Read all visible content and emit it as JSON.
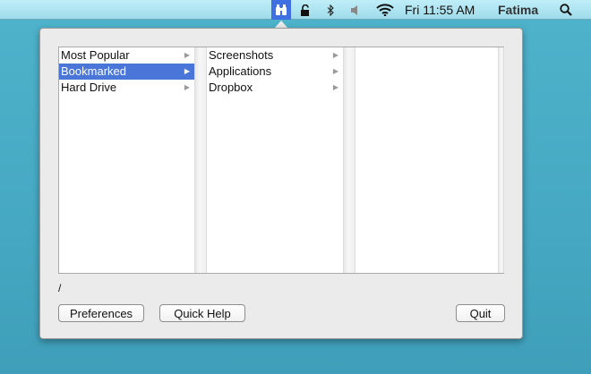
{
  "menubar": {
    "clock": "Fri 11:55 AM",
    "user": "Fatima",
    "icons": [
      "binoculars-icon",
      "lock-icon",
      "bluetooth-icon",
      "volume-icon",
      "wifi-icon",
      "spotlight-search-icon"
    ]
  },
  "columns": [
    [
      {
        "label": "Most Popular",
        "selected": false
      },
      {
        "label": "Bookmarked",
        "selected": true
      },
      {
        "label": "Hard Drive",
        "selected": false
      }
    ],
    [
      {
        "label": "Screenshots"
      },
      {
        "label": "Applications"
      },
      {
        "label": "Dropbox"
      }
    ],
    []
  ],
  "path": "/",
  "buttons": {
    "preferences": "Preferences",
    "quick_help": "Quick Help",
    "quit": "Quit"
  },
  "colors": {
    "selection": "#4a76d9",
    "desktop": "#46a8c2"
  }
}
